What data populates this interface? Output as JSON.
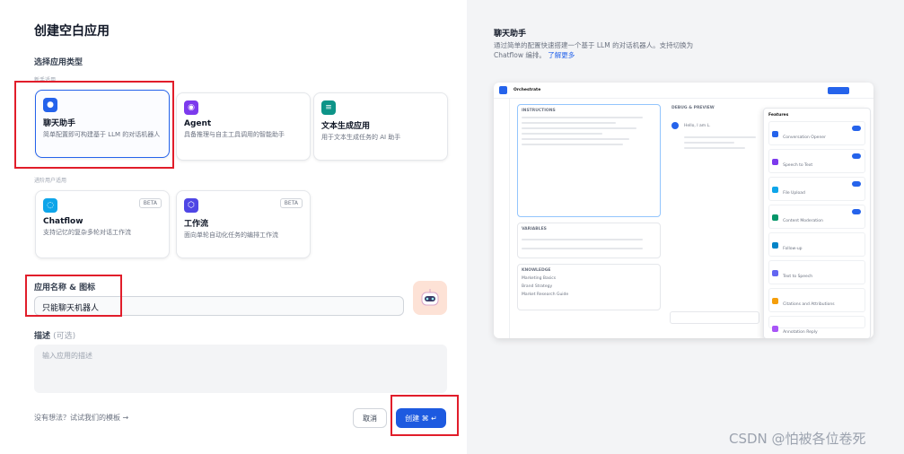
{
  "left": {
    "title": "创建空白应用",
    "section_type": "选择应用类型",
    "group_beginner": "新手适用",
    "group_advanced": "进阶用户适用",
    "cards": [
      {
        "name": "聊天助手",
        "desc": "简单配置即可构建基于 LLM 的对话机器人",
        "color": "#2563eb",
        "icon": "chat-bubble-icon"
      },
      {
        "name": "Agent",
        "desc": "具备推理与自主工具调用的智能助手",
        "color": "#7c3aed",
        "icon": "robot-icon"
      },
      {
        "name": "文本生成应用",
        "desc": "用于文本生成任务的 AI 助手",
        "color": "#0d9488",
        "icon": "text-icon"
      },
      {
        "name": "Chatflow",
        "desc": "支持记忆的复杂多轮对话工作流",
        "color": "#0ea5e9",
        "icon": "flow-icon",
        "badge": "BETA"
      },
      {
        "name": "工作流",
        "desc": "面向单轮自动化任务的编排工作流",
        "color": "#4f46e5",
        "icon": "workflow-icon",
        "badge": "BETA"
      }
    ],
    "name_label": "应用名称 & 图标",
    "name_value": "只能聊天机器人",
    "desc_label": "描述",
    "desc_optional": "(可选)",
    "desc_placeholder": "输入应用的描述",
    "template_link": "没有想法？试试我们的模板 →",
    "cancel": "取消",
    "create": "创建 ⌘ ↵"
  },
  "right": {
    "title": "聊天助手",
    "desc": "通过简单的配置快速搭建一个基于 LLM 的对话机器人。支持切换为 Chatflow 编排。",
    "learn_more": "了解更多",
    "preview": {
      "app_name": "Orchestrate",
      "instructions": "INSTRUCTIONS",
      "debug": "DEBUG & PREVIEW",
      "variables": "VARIABLES",
      "knowledge": "KNOWLEDGE",
      "kb_items": [
        "Marketing Basics",
        "Brand Strategy",
        "Market Research Guide"
      ],
      "greeting": "Hello, I am L.",
      "features_title": "Features",
      "features": [
        "Conversation Opener",
        "Speech to Text",
        "File Upload",
        "Content Moderation",
        "Follow-up",
        "Text to Speech",
        "Citations and Attributions",
        "Annotation Reply"
      ]
    }
  },
  "watermark": "CSDN @怕被各位卷死"
}
